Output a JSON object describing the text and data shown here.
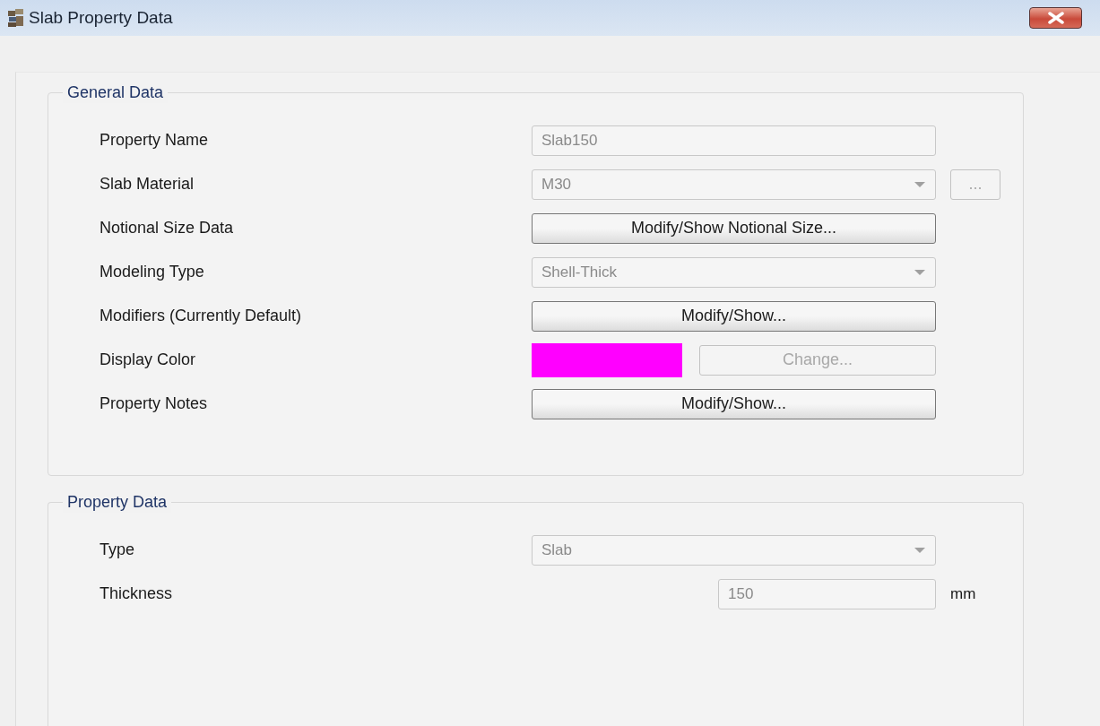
{
  "window": {
    "title": "Slab Property Data"
  },
  "groups": [
    {
      "title": "General Data",
      "rows": [
        {
          "label": "Property Name",
          "kind": "textbox",
          "value": "Slab150",
          "disabled": true
        },
        {
          "label": "Slab Material",
          "kind": "dropdown",
          "value": "M30",
          "disabled": true,
          "extra_button": {
            "text": "...",
            "disabled": true
          }
        },
        {
          "label": "Notional Size Data",
          "kind": "button",
          "text": "Modify/Show Notional Size...",
          "disabled": false
        },
        {
          "label": "Modeling Type",
          "kind": "dropdown",
          "value": "Shell-Thick",
          "disabled": true
        },
        {
          "label": "Modifiers (Currently Default)",
          "kind": "button",
          "text": "Modify/Show...",
          "disabled": false
        },
        {
          "label": "Display Color",
          "kind": "color",
          "color": "#ff00ff",
          "button": {
            "text": "Change...",
            "disabled": true
          }
        },
        {
          "label": "Property Notes",
          "kind": "button",
          "text": "Modify/Show...",
          "disabled": false
        }
      ]
    },
    {
      "title": "Property Data",
      "rows": [
        {
          "label": "Type",
          "kind": "dropdown",
          "value": "Slab",
          "disabled": true
        },
        {
          "label": "Thickness",
          "kind": "number",
          "value": "150",
          "unit": "mm",
          "disabled": true
        }
      ]
    }
  ]
}
